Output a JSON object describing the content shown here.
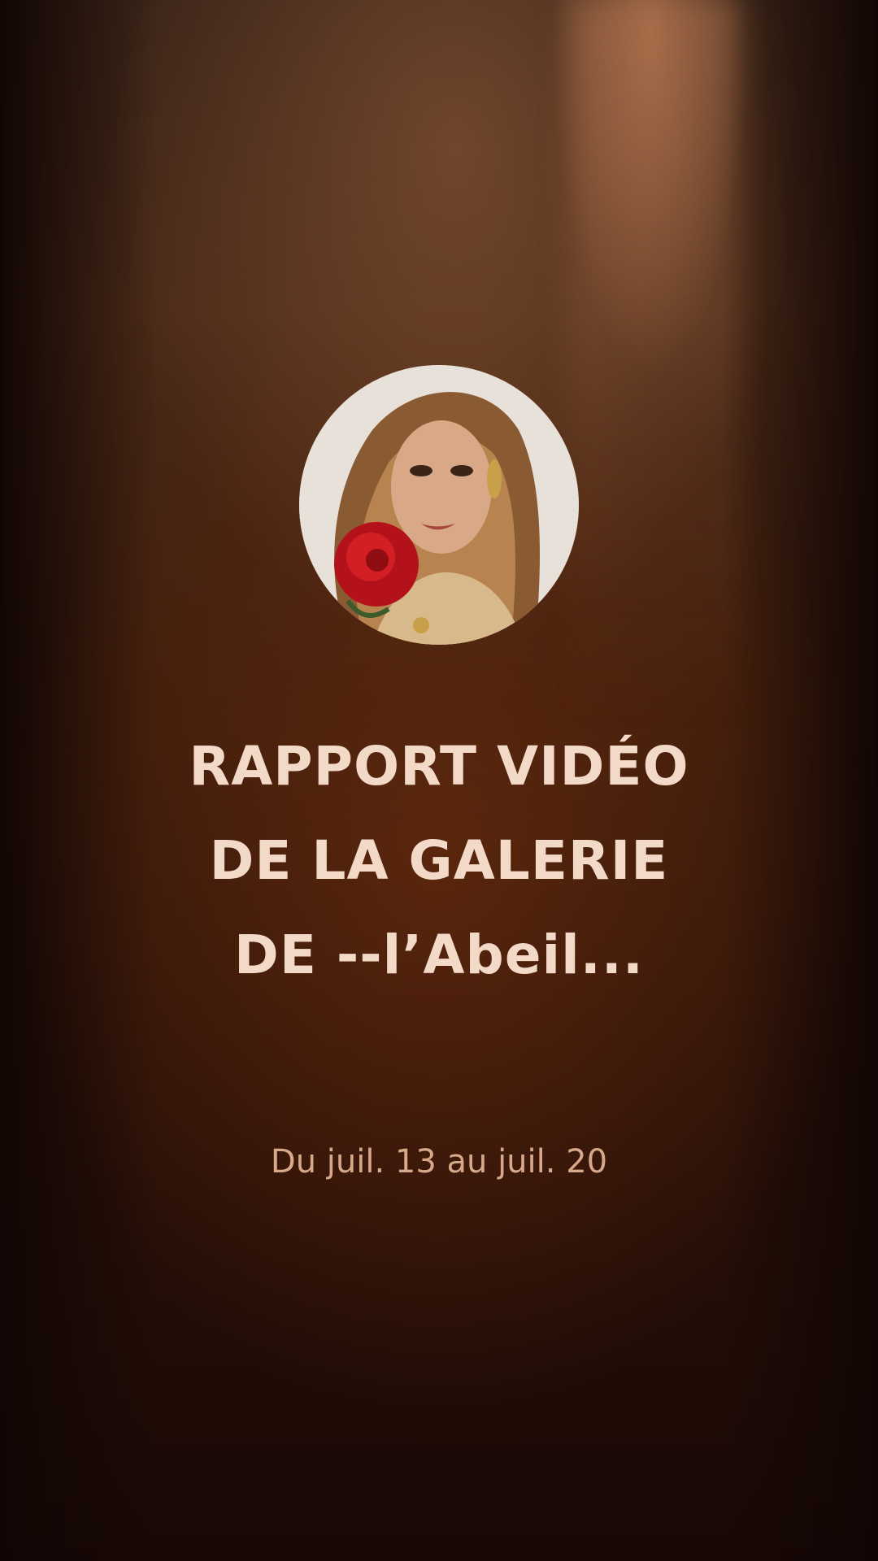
{
  "report": {
    "title_lines": [
      "RAPPORT VIDÉO",
      "DE LA GALERIE",
      "DE --l’Abeil..."
    ],
    "date_range": "Du juil. 13 au juil. 20"
  },
  "profile": {
    "avatar_icon": "profile-photo-icon"
  },
  "colors": {
    "title": "#f2d9c8",
    "date": "#d7a88a",
    "background_dark": "#1a0a06",
    "background_warm": "#4a2a18"
  }
}
